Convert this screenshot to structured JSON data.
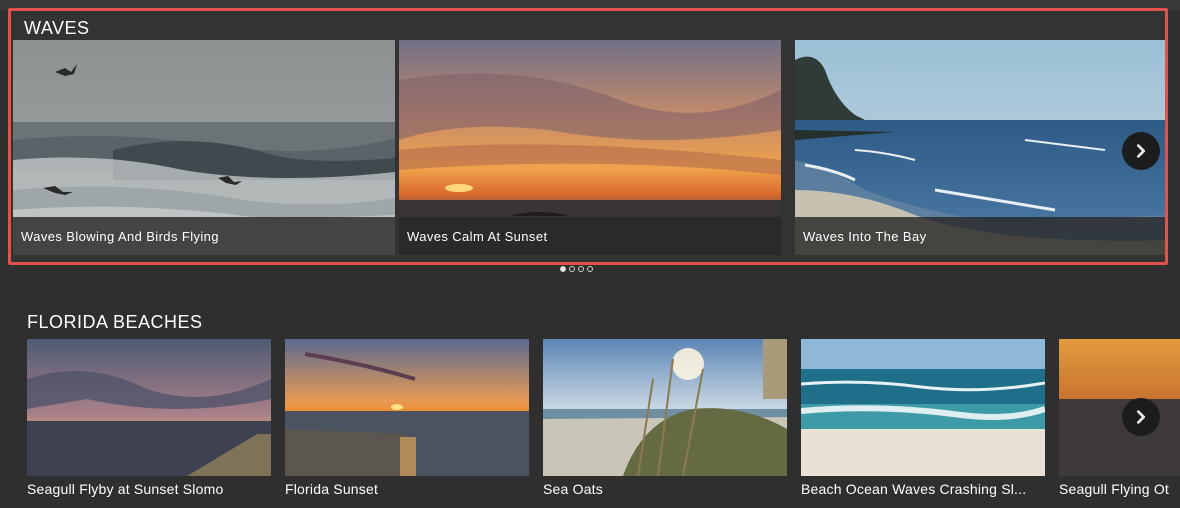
{
  "waves": {
    "title": "WAVES",
    "items": [
      {
        "label": "Waves Blowing And Birds Flying"
      },
      {
        "label": "Waves Calm At Sunset"
      },
      {
        "label": "Waves Into The Bay"
      }
    ],
    "next_icon": "chevron-right-icon",
    "pager": {
      "pages": 4,
      "active": 1
    }
  },
  "florida": {
    "title": "FLORIDA BEACHES",
    "items": [
      {
        "label": "Seagull Flyby at Sunset Slomo"
      },
      {
        "label": "Florida Sunset"
      },
      {
        "label": "Sea Oats"
      },
      {
        "label": "Beach Ocean Waves Crashing Sl..."
      },
      {
        "label": "Seagull Flying Ot"
      }
    ],
    "next_icon": "chevron-right-icon"
  },
  "colors": {
    "highlight_border": "#e3524a",
    "background": "#2f2f2f"
  }
}
